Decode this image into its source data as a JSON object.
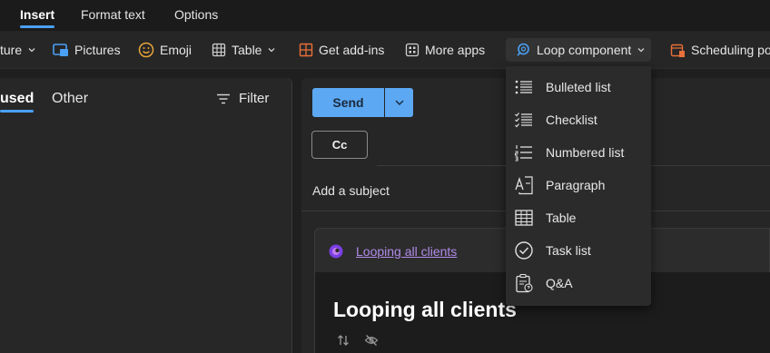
{
  "tabs": [
    {
      "label": "Insert",
      "active": true
    },
    {
      "label": "Format text",
      "active": false
    },
    {
      "label": "Options",
      "active": false
    }
  ],
  "ribbon": {
    "picture_partial": "ture",
    "pictures": "Pictures",
    "emoji": "Emoji",
    "table": "Table",
    "addins": "Get add-ins",
    "moreapps": "More apps",
    "loop": "Loop component",
    "scheduling": "Scheduling po"
  },
  "inbox": {
    "focused_partial": "used",
    "other": "Other",
    "filter": "Filter"
  },
  "compose": {
    "send": "Send",
    "cc": "Cc",
    "subject_placeholder": "Add a subject",
    "loop_link": "Looping all clients",
    "loop_title": "Looping all clients"
  },
  "loop_menu": {
    "items": [
      {
        "label": "Bulleted list",
        "icon": "bulleted-list-icon"
      },
      {
        "label": "Checklist",
        "icon": "checklist-icon"
      },
      {
        "label": "Numbered list",
        "icon": "numbered-list-icon"
      },
      {
        "label": "Paragraph",
        "icon": "paragraph-icon"
      },
      {
        "label": "Table",
        "icon": "table-icon"
      },
      {
        "label": "Task list",
        "icon": "task-list-icon"
      },
      {
        "label": "Q&A",
        "icon": "qa-icon"
      }
    ]
  },
  "colors": {
    "accent": "#4aa0f5",
    "send_button": "#5ca8f3",
    "loop_link": "#b08be8",
    "emoji_yellow": "#e8a53a",
    "addins_orange": "#e8703a"
  }
}
